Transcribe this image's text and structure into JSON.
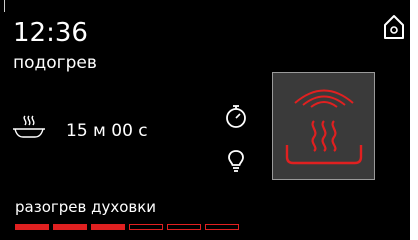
{
  "status": {
    "time": "12:36",
    "mode_name": "подогрев"
  },
  "dish": {
    "icon": "steaming-dish-icon",
    "duration": "15 м 00 с"
  },
  "controls": {
    "home_icon": "home-icon",
    "timer_icon": "stopwatch-icon",
    "lamp_icon": "oven-light-icon",
    "selected_mode_icon": "reheat-mode-icon"
  },
  "preheat": {
    "label": "разогрев духовки",
    "filled_segments": 3,
    "total_segments": 6,
    "color": "#e02020"
  }
}
